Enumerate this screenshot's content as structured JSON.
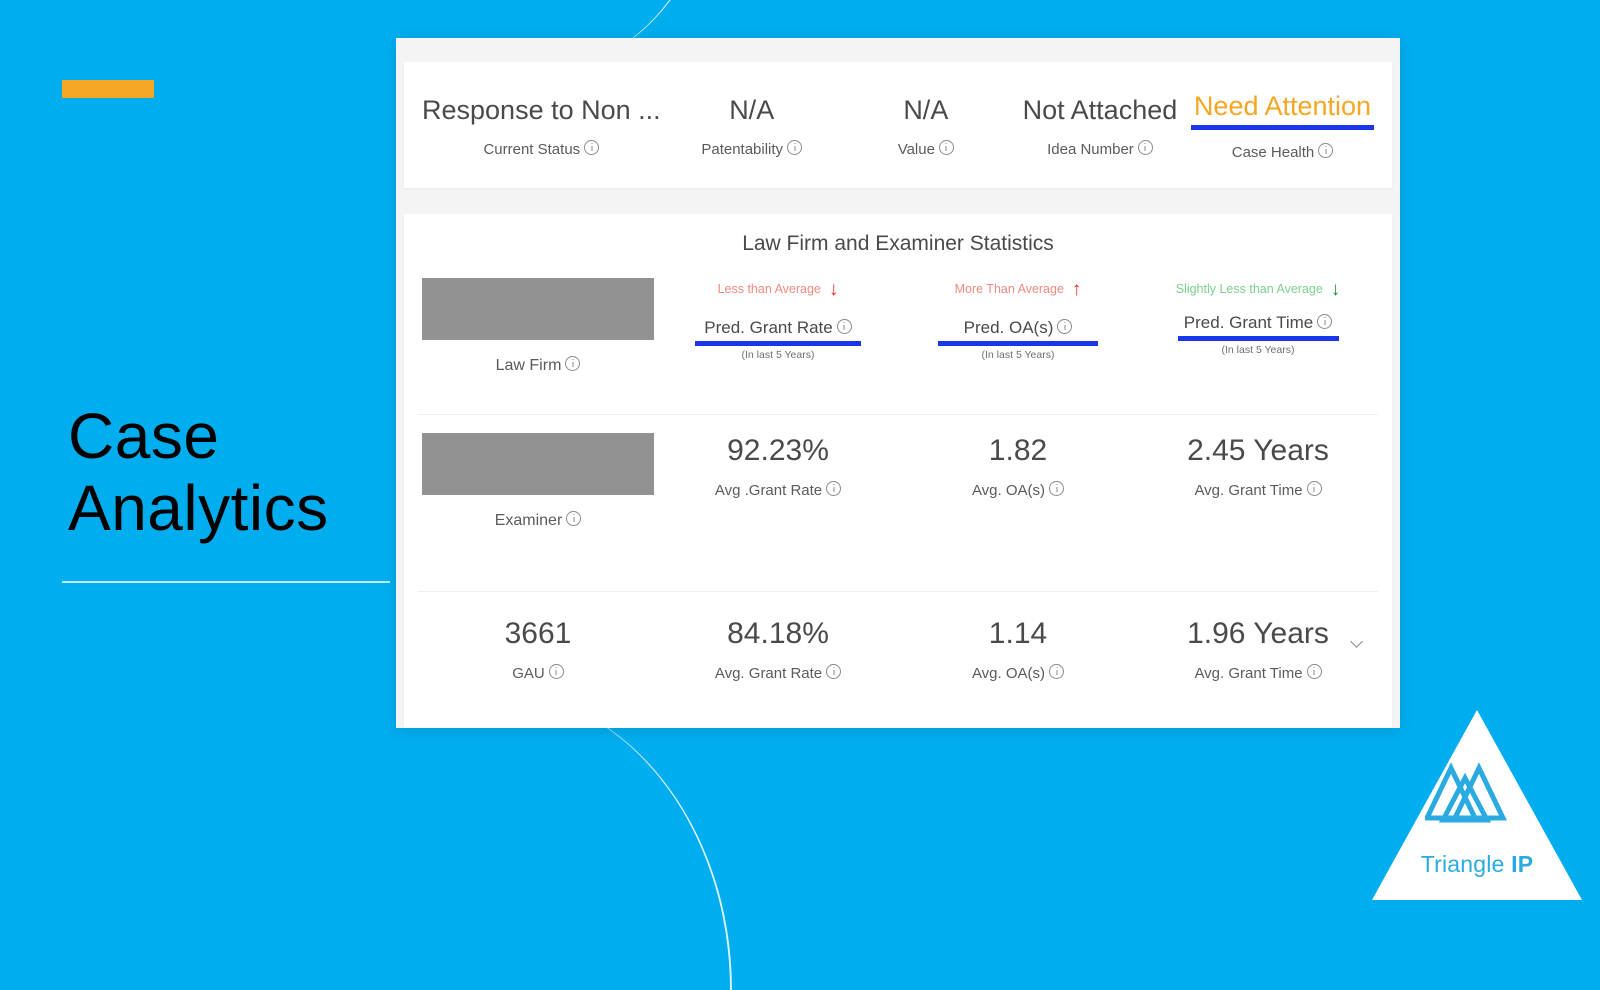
{
  "background": {
    "brand_blue": "#00aeef",
    "accent_orange": "#f5a623"
  },
  "left_panel": {
    "title_line1": "Case",
    "title_line2": "Analytics"
  },
  "summary": {
    "cells": [
      {
        "value": "Response to Non ...",
        "label": "Current Status",
        "accent": false,
        "underline": false
      },
      {
        "value": "N/A",
        "label": "Patentability",
        "accent": false,
        "underline": false
      },
      {
        "value": "N/A",
        "label": "Value",
        "accent": false,
        "underline": false
      },
      {
        "value": "Not Attached",
        "label": "Idea Number",
        "accent": false,
        "underline": false
      },
      {
        "value": "Need Attention",
        "label": "Case Health",
        "accent": true,
        "underline": true
      }
    ]
  },
  "stats": {
    "title": "Law Firm and Examiner Statistics",
    "header_row": {
      "entity_caption": "Law Firm",
      "columns": [
        {
          "trend_text": "Less than Average",
          "trend_direction": "down",
          "trend_tone": "low",
          "pred_label": "Pred. Grant Rate",
          "pred_sub": "(In last 5 Years)"
        },
        {
          "trend_text": "More Than Average",
          "trend_direction": "up",
          "trend_tone": "high",
          "pred_label": "Pred. OA(s)",
          "pred_sub": "(In last 5 Years)"
        },
        {
          "trend_text": "Slightly Less than Average",
          "trend_direction": "down",
          "trend_tone": "slight",
          "pred_label": "Pred. Grant Time",
          "pred_sub": "(In last 5 Years)"
        }
      ]
    },
    "examiner_row": {
      "entity_caption": "Examiner",
      "metrics": [
        {
          "value": "92.23%",
          "label": "Avg .Grant Rate"
        },
        {
          "value": "1.82",
          "label": "Avg. OA(s)"
        },
        {
          "value": "2.45 Years",
          "label": "Avg. Grant Time"
        }
      ]
    },
    "gau_row": {
      "metrics": [
        {
          "value": "3661",
          "label": "GAU"
        },
        {
          "value": "84.18%",
          "label": "Avg. Grant Rate"
        },
        {
          "value": "1.14",
          "label": "Avg. OA(s)"
        },
        {
          "value": "1.96 Years",
          "label": "Avg. Grant Time"
        }
      ]
    }
  },
  "logo": {
    "name_regular": "Triangle ",
    "name_bold": "IP",
    "color": "#29abe2"
  }
}
